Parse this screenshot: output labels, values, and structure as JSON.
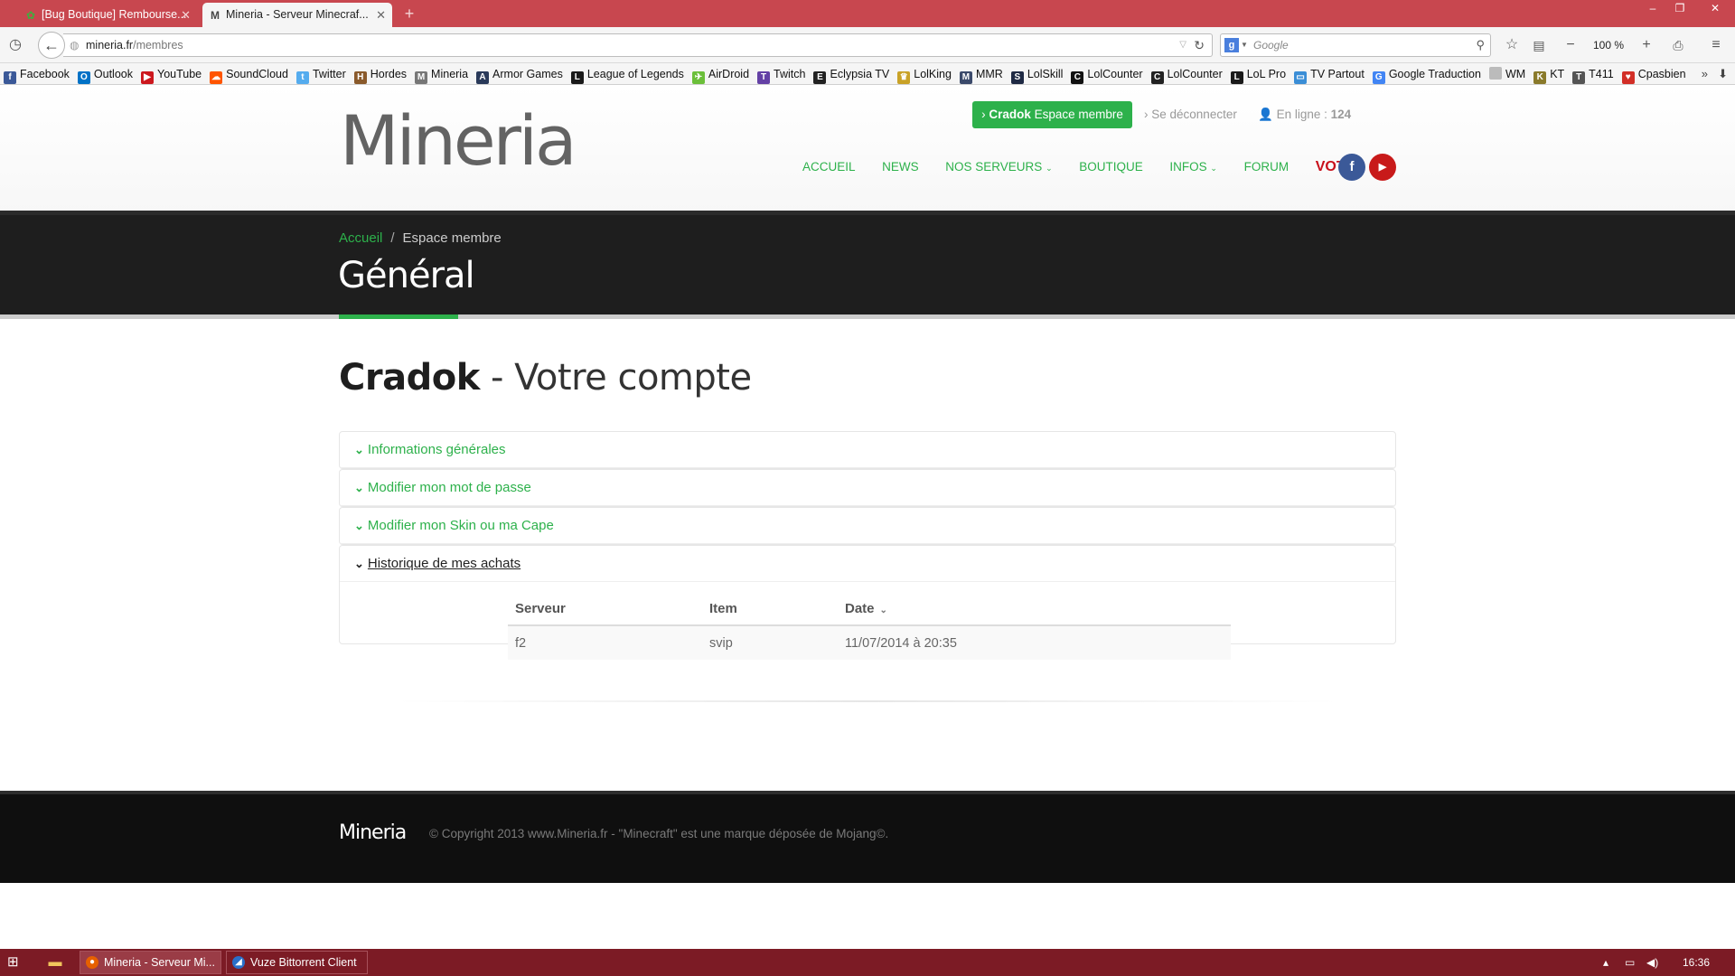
{
  "browser": {
    "tabs": [
      {
        "label": "[Bug Boutique] Remboursе...",
        "icon": "leaf-icon"
      },
      {
        "label": "Mineria - Serveur Minecraf...",
        "icon": "mineria-icon"
      }
    ],
    "url_host": "mineria.fr",
    "url_path": "/membres",
    "search_placeholder": "Google",
    "zoom": "100 %",
    "bookmarks": [
      {
        "label": "Facebook",
        "color": "#3b5998",
        "glyph": "f"
      },
      {
        "label": "Outlook",
        "color": "#0072c6",
        "glyph": "O"
      },
      {
        "label": "YouTube",
        "color": "#cc181e",
        "glyph": "▶"
      },
      {
        "label": "SoundCloud",
        "color": "#ff5500",
        "glyph": "☁"
      },
      {
        "label": "Twitter",
        "color": "#55acee",
        "glyph": "t"
      },
      {
        "label": "Hordes",
        "color": "#8a5a2b",
        "glyph": "H"
      },
      {
        "label": "Mineria",
        "color": "#777777",
        "glyph": "M"
      },
      {
        "label": "Armor Games",
        "color": "#2a3a5a",
        "glyph": "A"
      },
      {
        "label": "League of Legends",
        "color": "#1a1a1a",
        "glyph": "L"
      },
      {
        "label": "AirDroid",
        "color": "#6bbf3a",
        "glyph": "✈"
      },
      {
        "label": "Twitch",
        "color": "#6441a5",
        "glyph": "T"
      },
      {
        "label": "Eclypsia TV",
        "color": "#222222",
        "glyph": "E"
      },
      {
        "label": "LolKing",
        "color": "#c9a227",
        "glyph": "♛"
      },
      {
        "label": "MMR",
        "color": "#3b4a6b",
        "glyph": "M"
      },
      {
        "label": "LolSkill",
        "color": "#1f2a44",
        "glyph": "S"
      },
      {
        "label": "LolCounter",
        "color": "#111111",
        "glyph": "C"
      },
      {
        "label": "LolCounter",
        "color": "#222222",
        "glyph": "C"
      },
      {
        "label": "LoL Pro",
        "color": "#1a1a1a",
        "glyph": "L"
      },
      {
        "label": "TV Partout",
        "color": "#3b8ed6",
        "glyph": "▭"
      },
      {
        "label": "Google Traduction",
        "color": "#4285f4",
        "glyph": "G"
      },
      {
        "label": "WM",
        "color": "#bbbbbb",
        "glyph": " "
      },
      {
        "label": "KT",
        "color": "#8a7a2b",
        "glyph": "K"
      },
      {
        "label": "T411",
        "color": "#555555",
        "glyph": "T"
      },
      {
        "label": "Cpasbien",
        "color": "#d22f27",
        "glyph": "♥"
      }
    ]
  },
  "site": {
    "logo": "Mineria",
    "member_button_user": "Cradok",
    "member_button_label": "Espace membre",
    "logout_label": "Se déconnecter",
    "online_label": "En ligne :",
    "online_count": "124",
    "menu": [
      "ACCUEIL",
      "NEWS",
      "NOS SERVEURS",
      "BOUTIQUE",
      "INFOS",
      "FORUM",
      "VOTE"
    ],
    "breadcrumb_home": "Accueil",
    "breadcrumb_current": "Espace membre",
    "page_title": "Général",
    "account_user": "Cradok",
    "account_suffix": "- Votre compte",
    "panels": [
      "Informations générales",
      "Modifier mon mot de passe",
      "Modifier mon Skin ou ma Cape",
      "Historique de mes achats"
    ],
    "orders": {
      "headers": [
        "Serveur",
        "Item",
        "Date"
      ],
      "rows": [
        {
          "serveur": "f2",
          "item": "svip",
          "date": "11/07/2014 à 20:35"
        }
      ]
    },
    "footer_logo": "Mineria",
    "copyright": "© Copyright 2013 www.Mineria.fr - \"Minecraft\" est une marque déposée de Mojang©."
  },
  "taskbar": {
    "apps": [
      "Mineria - Serveur Mi...",
      "Vuze Bittorrent Client"
    ],
    "clock": "16:36"
  }
}
